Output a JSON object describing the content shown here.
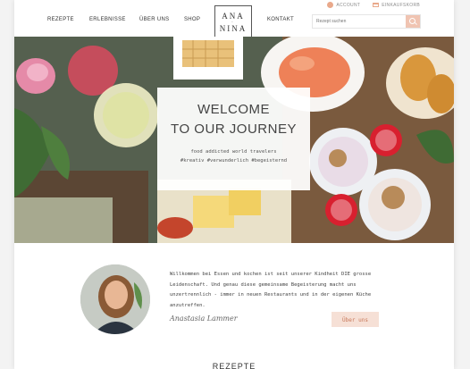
{
  "utility": {
    "account_label": "ACCOUNT",
    "cart_label": "EINKAUFSKORB"
  },
  "nav": {
    "items": [
      "REZEPTE",
      "ERLEBNISSE",
      "ÜBER UNS",
      "SHOP",
      "KONTAKT"
    ]
  },
  "logo": {
    "line1": "ANA",
    "line2": "NINA"
  },
  "search": {
    "placeholder": "Rezept suchen"
  },
  "hero": {
    "title_line1": "WELCOME",
    "title_line2": "TO OUR JOURNEY",
    "subtitle_line1": "food addicted world travelers",
    "subtitle_line2": "#kreativ #verwunderlich #begeisternd"
  },
  "intro": {
    "text": "Willkommen bei Essen und kochen ist seit unserer Kindheit DIE grosse Leidenschaft. Und genau diese gemeinsame Begeisterung macht uns unzertrennlich - immer in neuen Restaurants und in der eigenen Küche anzutreffen.",
    "signature": "Anastasia Lammer",
    "button_label": "Über uns"
  },
  "section": {
    "title": "REZEPTE"
  },
  "colors": {
    "accent": "#f0c4b2",
    "accent_text": "#c8785a"
  }
}
